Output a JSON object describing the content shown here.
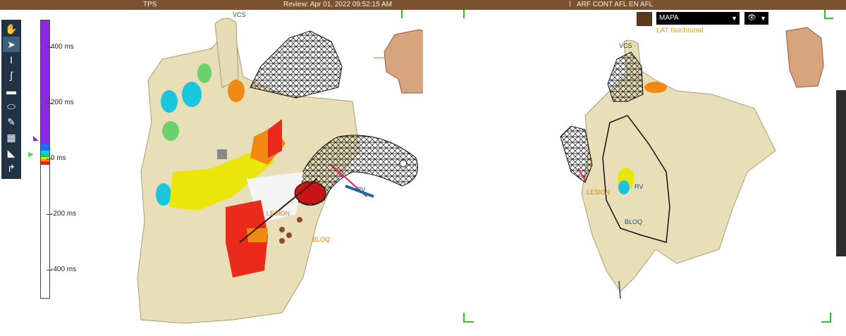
{
  "topbar": {
    "left_title": "TPS",
    "review_text": "Review: Apr 01, 2022 09:52:15 AM",
    "study_title": "ARF CONT AFL EN AFL"
  },
  "toolbar": {
    "tools": [
      {
        "name": "hand-icon",
        "glyph": "✋"
      },
      {
        "name": "pointer-icon",
        "glyph": "➤"
      },
      {
        "name": "measure-icon",
        "glyph": "I"
      },
      {
        "name": "curve-icon",
        "glyph": "∫"
      },
      {
        "name": "ruler-icon",
        "glyph": "▬"
      },
      {
        "name": "ellipse-icon",
        "glyph": "⬭"
      },
      {
        "name": "pencil-icon",
        "glyph": "✎"
      },
      {
        "name": "map-layer-icon",
        "glyph": "▦"
      },
      {
        "name": "split-icon",
        "glyph": "◣"
      },
      {
        "name": "catheter-icon",
        "glyph": "↱"
      }
    ]
  },
  "scale": {
    "ticks": [
      {
        "label": "400 ms",
        "value": 400
      },
      {
        "label": "200 ms",
        "value": 200
      },
      {
        "label": "0 ms",
        "value": 0
      },
      {
        "label": "-200 ms",
        "value": -200
      },
      {
        "label": "-400 ms",
        "value": -400
      }
    ],
    "colors": {
      "high": "#8a2be2",
      "mid_blue": "#1e6bff",
      "cyan": "#00d4e6",
      "green": "#22cc33",
      "yellow": "#ffe600",
      "orange": "#ff8a00",
      "red": "#ff1a1a"
    }
  },
  "left_view": {
    "labels": {
      "vcs": "VCS",
      "lesion": "LESION",
      "rv": "RV",
      "bloq": "BLOQ"
    }
  },
  "right_view": {
    "map_select": "MAPA",
    "map_type": "LAT Isochronal",
    "labels": {
      "vcs": "VCS",
      "lesion": "LESION",
      "rv": "RV",
      "bloq": "BLOQ"
    }
  }
}
